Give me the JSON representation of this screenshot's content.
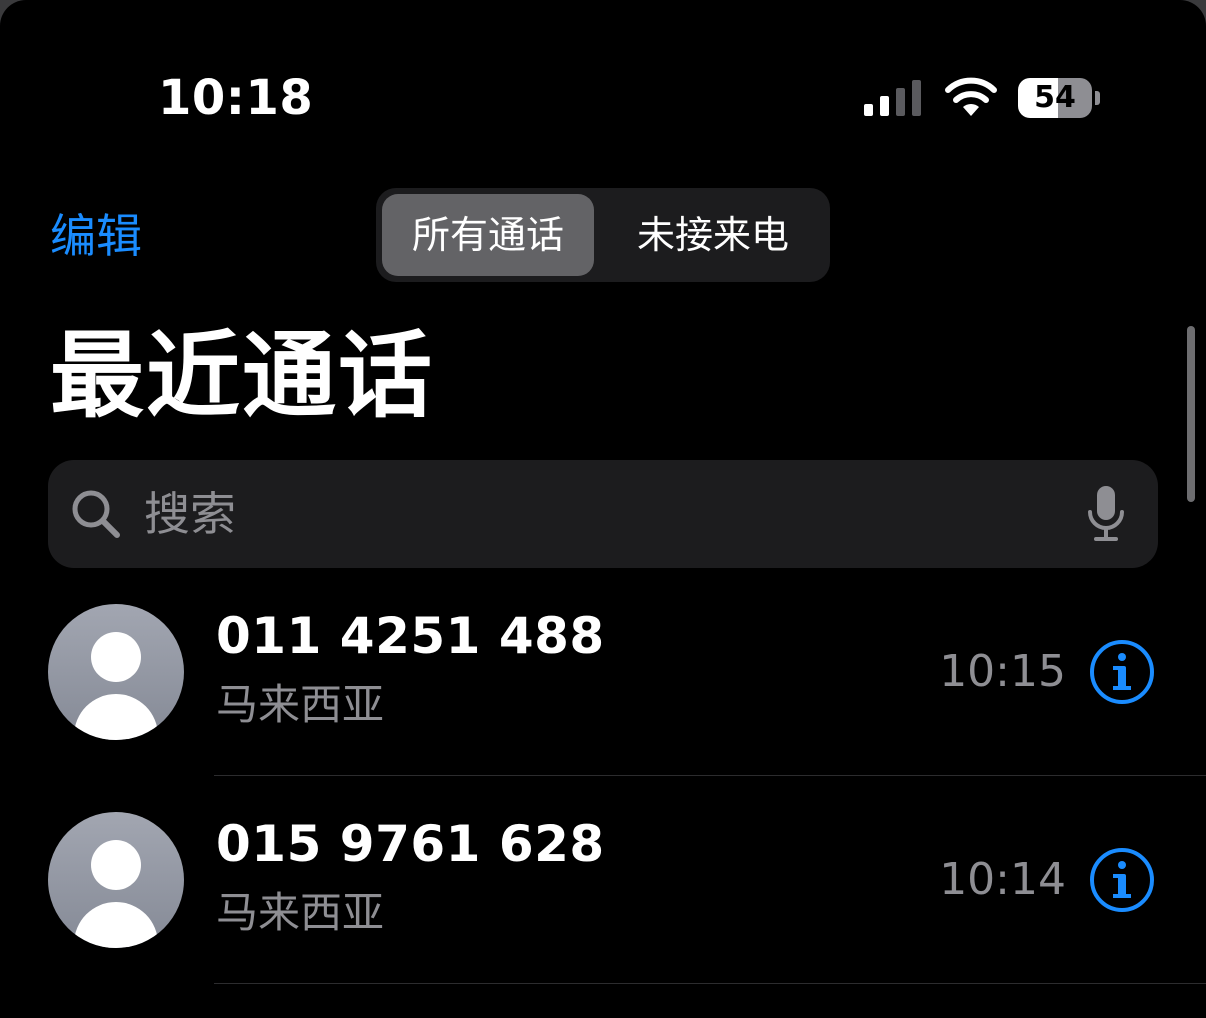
{
  "status_bar": {
    "time": "10:18",
    "battery": "54"
  },
  "nav": {
    "edit_label": "编辑",
    "segments": [
      {
        "label": "所有通话",
        "active": true
      },
      {
        "label": "未接来电",
        "active": false
      }
    ]
  },
  "title": "最近通话",
  "search": {
    "placeholder": "搜索"
  },
  "calls": [
    {
      "number": "011 4251 488",
      "location": "马来西亚",
      "time": "10:15"
    },
    {
      "number": "015 9761 628",
      "location": "马来西亚",
      "time": "10:14"
    }
  ],
  "colors": {
    "accent": "#1a8cff",
    "background": "#000000",
    "secondary_text": "#8e8e93"
  },
  "icons": {
    "signal": "cellular-signal-icon",
    "wifi": "wifi-icon",
    "battery": "battery-icon",
    "search": "search-icon",
    "mic": "microphone-icon",
    "info": "info-icon",
    "avatar": "person-avatar-icon"
  }
}
